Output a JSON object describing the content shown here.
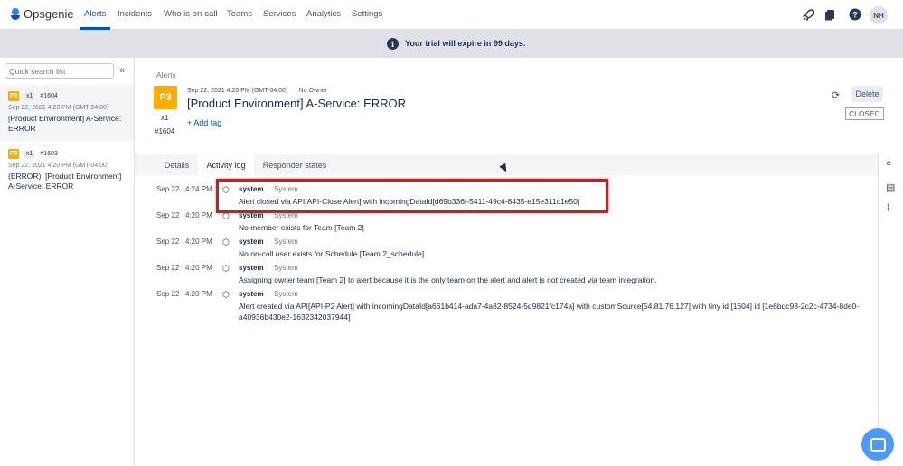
{
  "topnav": {
    "brand": "Opsgenie",
    "items": [
      {
        "label": "Alerts",
        "active": true
      },
      {
        "label": "Incidents"
      },
      {
        "label": "Who is on-call"
      },
      {
        "label": "Teams"
      },
      {
        "label": "Services"
      },
      {
        "label": "Analytics"
      },
      {
        "label": "Settings"
      }
    ],
    "icons": [
      "rocket-icon",
      "book-icon",
      "help-icon"
    ],
    "avatar": "NH",
    "accent": "#0052cc"
  },
  "trial": {
    "text": "Your trial will expire in 99 days."
  },
  "sidebar": {
    "search_placeholder": "Quick search list",
    "alerts": [
      {
        "priority": "P3",
        "count": "x1",
        "id": "#1604",
        "date": "Sep 22, 2021 4:20 PM (GMT-04:00)",
        "title": "[Product Environment] A-Service: ERROR",
        "selected": true
      },
      {
        "priority": "P3",
        "count": "x1",
        "id": "#1603",
        "date": "Sep 22, 2021 4:20 PM (GMT-04:00)",
        "title": "(ERROR): [Product Environment] A-Service: ERROR",
        "selected": false
      }
    ]
  },
  "detail": {
    "breadcrumb": "Alerts",
    "priority": "P3",
    "count": "x1",
    "id": "#1604",
    "date": "Sep 22, 2021 4:20 PM (GMT-04:00)",
    "owner": "No Owner",
    "title": "[Product Environment] A-Service: ERROR",
    "add_tag": "+ Add tag",
    "delete_label": "Delete",
    "status": "CLOSED",
    "priority_color": "#ffab00"
  },
  "tabs": [
    {
      "label": "Details"
    },
    {
      "label": "Activity log",
      "active": true
    },
    {
      "label": "Responder states"
    }
  ],
  "activity_log": [
    {
      "date": "Sep 22",
      "time": "4:24 PM",
      "user": "system",
      "source": "System",
      "message": "Alert closed via API[API-Close Alert] with incomingDataId[d69b336f-5411-49c4-8435-e15e311c1e50]",
      "highlighted": true
    },
    {
      "date": "Sep 22",
      "time": "4:20 PM",
      "user": "system",
      "source": "System",
      "message": "No member exists for Team [Team 2]"
    },
    {
      "date": "Sep 22",
      "time": "4:20 PM",
      "user": "system",
      "source": "System",
      "message": "No on-call user exists for Schedule [Team 2_schedule]"
    },
    {
      "date": "Sep 22",
      "time": "4:20 PM",
      "user": "system",
      "source": "System",
      "message": "Assigning owner team [Team 2] to alert because it is the only team on the alert and alert is not created via team integration."
    },
    {
      "date": "Sep 22",
      "time": "4:20 PM",
      "user": "system",
      "source": "System",
      "message": "Alert created via API[API-P2 Alert] with incomingDataId[a661b414-ada7-4a82-8524-5d9821fc174a] with customSource[54.81.76.127] with tiny id [1604] id [1e6bdc93-2c2c-4734-8de0-a40936b430e2-1632342037944]"
    }
  ]
}
